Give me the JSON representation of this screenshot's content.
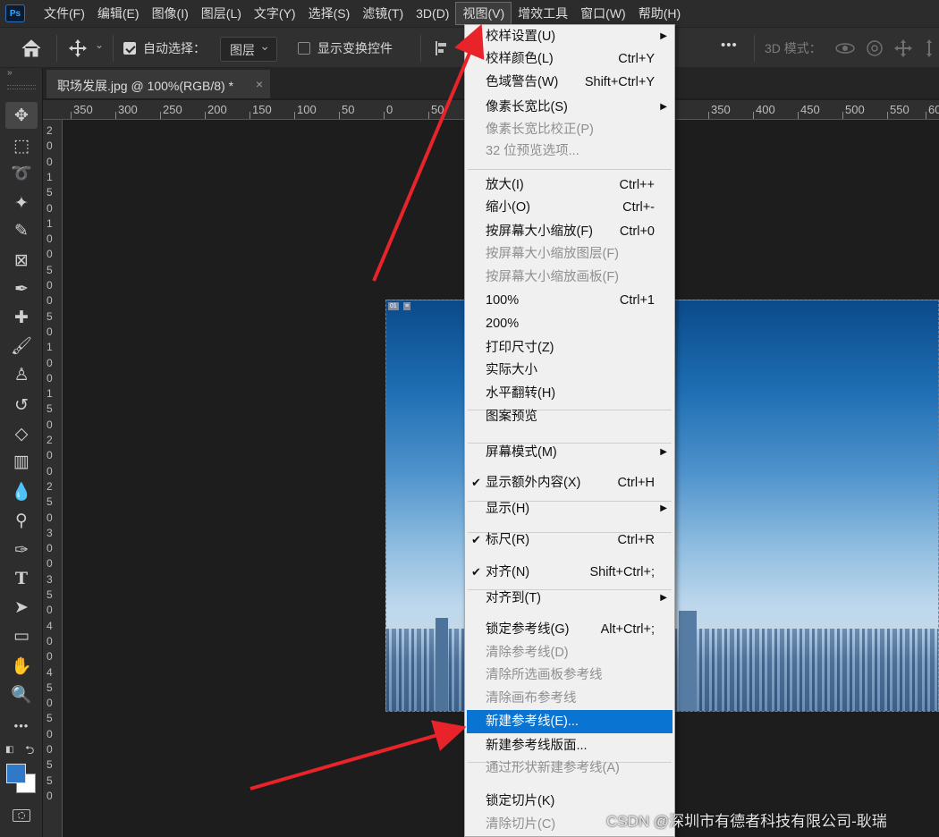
{
  "app": {
    "logo": "Ps"
  },
  "menubar": {
    "items": [
      "文件(F)",
      "编辑(E)",
      "图像(I)",
      "图层(L)",
      "文字(Y)",
      "选择(S)",
      "滤镜(T)",
      "3D(D)",
      "视图(V)",
      "增效工具",
      "窗口(W)",
      "帮助(H)"
    ],
    "active": "视图(V)"
  },
  "options": {
    "auto_select_label": "自动选择：",
    "auto_select_checked": true,
    "layer_dropdown": "图层",
    "show_transform_label": "显示变换控件",
    "show_transform_checked": false,
    "more_label": "•••",
    "mode_3d_label": "3D 模式："
  },
  "document": {
    "tab_title": "职场发展.jpg @ 100%(RGB/8) *",
    "close_glyph": "×",
    "badge_1": "01",
    "badge_2": "≡"
  },
  "ruler": {
    "h_ticks": [
      "350",
      "300",
      "250",
      "200",
      "150",
      "100",
      "50",
      "0",
      "50",
      "350",
      "400",
      "450",
      "500",
      "550",
      "60"
    ],
    "v_ticks": [
      "2",
      "0",
      "0",
      "1",
      "5",
      "0",
      "1",
      "0",
      "0",
      "5",
      "0",
      "0",
      "5",
      "0",
      "1",
      "0",
      "0",
      "1",
      "5",
      "0",
      "2",
      "0",
      "0",
      "2",
      "5",
      "0",
      "3",
      "0",
      "0",
      "3",
      "5",
      "0",
      "4",
      "0",
      "0",
      "4",
      "5",
      "0",
      "5",
      "0",
      "0",
      "5",
      "5",
      "0"
    ]
  },
  "view_menu": {
    "items": [
      {
        "label": "校样设置(U)",
        "shortcut": "",
        "submenu": true,
        "disabled": false,
        "checked": false
      },
      {
        "label": "校样颜色(L)",
        "shortcut": "Ctrl+Y",
        "submenu": false,
        "disabled": false,
        "checked": false
      },
      {
        "label": "色域警告(W)",
        "shortcut": "Shift+Ctrl+Y",
        "submenu": false,
        "disabled": false,
        "checked": false
      },
      {
        "label": "像素长宽比(S)",
        "shortcut": "",
        "submenu": true,
        "disabled": false,
        "checked": false
      },
      {
        "label": "像素长宽比校正(P)",
        "shortcut": "",
        "submenu": false,
        "disabled": true,
        "checked": false
      },
      {
        "label": "32 位预览选项...",
        "shortcut": "",
        "submenu": false,
        "disabled": true,
        "checked": false
      },
      {
        "label": "放大(I)",
        "shortcut": "Ctrl++",
        "submenu": false,
        "disabled": false,
        "checked": false
      },
      {
        "label": "缩小(O)",
        "shortcut": "Ctrl+-",
        "submenu": false,
        "disabled": false,
        "checked": false
      },
      {
        "label": "按屏幕大小缩放(F)",
        "shortcut": "Ctrl+0",
        "submenu": false,
        "disabled": false,
        "checked": false
      },
      {
        "label": "按屏幕大小缩放图层(F)",
        "shortcut": "",
        "submenu": false,
        "disabled": true,
        "checked": false
      },
      {
        "label": "按屏幕大小缩放画板(F)",
        "shortcut": "",
        "submenu": false,
        "disabled": true,
        "checked": false
      },
      {
        "label": "100%",
        "shortcut": "Ctrl+1",
        "submenu": false,
        "disabled": false,
        "checked": false
      },
      {
        "label": "200%",
        "shortcut": "",
        "submenu": false,
        "disabled": false,
        "checked": false
      },
      {
        "label": "打印尺寸(Z)",
        "shortcut": "",
        "submenu": false,
        "disabled": false,
        "checked": false
      },
      {
        "label": "实际大小",
        "shortcut": "",
        "submenu": false,
        "disabled": false,
        "checked": false
      },
      {
        "label": "水平翻转(H)",
        "shortcut": "",
        "submenu": false,
        "disabled": false,
        "checked": false
      },
      {
        "label": "图案预览",
        "shortcut": "",
        "submenu": false,
        "disabled": false,
        "checked": false
      },
      {
        "label": "屏幕模式(M)",
        "shortcut": "",
        "submenu": true,
        "disabled": false,
        "checked": false
      },
      {
        "label": "显示额外内容(X)",
        "shortcut": "Ctrl+H",
        "submenu": false,
        "disabled": false,
        "checked": true
      },
      {
        "label": "显示(H)",
        "shortcut": "",
        "submenu": true,
        "disabled": false,
        "checked": false
      },
      {
        "label": "标尺(R)",
        "shortcut": "Ctrl+R",
        "submenu": false,
        "disabled": false,
        "checked": true
      },
      {
        "label": "对齐(N)",
        "shortcut": "Shift+Ctrl+;",
        "submenu": false,
        "disabled": false,
        "checked": true
      },
      {
        "label": "对齐到(T)",
        "shortcut": "",
        "submenu": true,
        "disabled": false,
        "checked": false
      },
      {
        "label": "锁定参考线(G)",
        "shortcut": "Alt+Ctrl+;",
        "submenu": false,
        "disabled": false,
        "checked": false
      },
      {
        "label": "清除参考线(D)",
        "shortcut": "",
        "submenu": false,
        "disabled": true,
        "checked": false
      },
      {
        "label": "清除所选画板参考线",
        "shortcut": "",
        "submenu": false,
        "disabled": true,
        "checked": false
      },
      {
        "label": "清除画布参考线",
        "shortcut": "",
        "submenu": false,
        "disabled": true,
        "checked": false
      },
      {
        "label": "新建参考线(E)...",
        "shortcut": "",
        "submenu": false,
        "disabled": false,
        "checked": false,
        "highlighted": true
      },
      {
        "label": "新建参考线版面...",
        "shortcut": "",
        "submenu": false,
        "disabled": false,
        "checked": false
      },
      {
        "label": "通过形状新建参考线(A)",
        "shortcut": "",
        "submenu": false,
        "disabled": true,
        "checked": false
      },
      {
        "label": "锁定切片(K)",
        "shortcut": "",
        "submenu": false,
        "disabled": false,
        "checked": false
      },
      {
        "label": "清除切片(C)",
        "shortcut": "",
        "submenu": false,
        "disabled": true,
        "checked": false
      }
    ]
  },
  "tools": [
    "move-tool",
    "marquee-tool",
    "lasso-tool",
    "magic-wand-tool",
    "selection-brush-tool",
    "frame-tool",
    "eyedropper-tool",
    "healing-brush-tool",
    "brush-tool",
    "clone-stamp-tool",
    "history-brush-tool",
    "eraser-tool",
    "gradient-tool",
    "blur-tool",
    "dodge-tool",
    "pen-tool",
    "type-tool",
    "path-selection-tool",
    "rectangle-tool",
    "hand-tool",
    "zoom-tool",
    "more-tools"
  ],
  "colors": {
    "foreground": "#2f79c8",
    "background": "#ffffff",
    "highlight": "#0a74d2",
    "arrow": "#e8232a"
  },
  "watermark": "CSDN @深圳市有德者科技有限公司-耿瑞"
}
